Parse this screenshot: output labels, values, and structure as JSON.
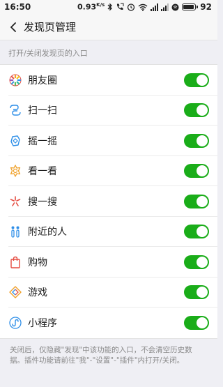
{
  "status_bar": {
    "time": "16:50",
    "speed_value": "0.93",
    "speed_unit": "K/s",
    "battery": "92",
    "battery_level": 0.92
  },
  "header": {
    "title": "发现页管理"
  },
  "section": {
    "title": "打开/关闭发现页的入口"
  },
  "items": [
    {
      "label": "朋友圈",
      "icon": "moments-icon",
      "enabled": true
    },
    {
      "label": "扫一扫",
      "icon": "scan-icon",
      "enabled": true
    },
    {
      "label": "摇一摇",
      "icon": "shake-icon",
      "enabled": true
    },
    {
      "label": "看一看",
      "icon": "top-stories-icon",
      "enabled": true
    },
    {
      "label": "搜一搜",
      "icon": "search-icon",
      "enabled": true
    },
    {
      "label": "附近的人",
      "icon": "people-nearby-icon",
      "enabled": true
    },
    {
      "label": "购物",
      "icon": "shopping-bag-icon",
      "enabled": true
    },
    {
      "label": "游戏",
      "icon": "games-icon",
      "enabled": true
    },
    {
      "label": "小程序",
      "icon": "mini-program-icon",
      "enabled": true
    }
  ],
  "footer": {
    "note": "关闭后，仅隐藏\"发现\"中该功能的入口，不会清空历史数据。插件功能请前往\"我\"-\"设置\"-\"插件\"内打开/关闭。"
  },
  "colors": {
    "toggle_on": "#1aad19",
    "background": "#efeff4"
  }
}
